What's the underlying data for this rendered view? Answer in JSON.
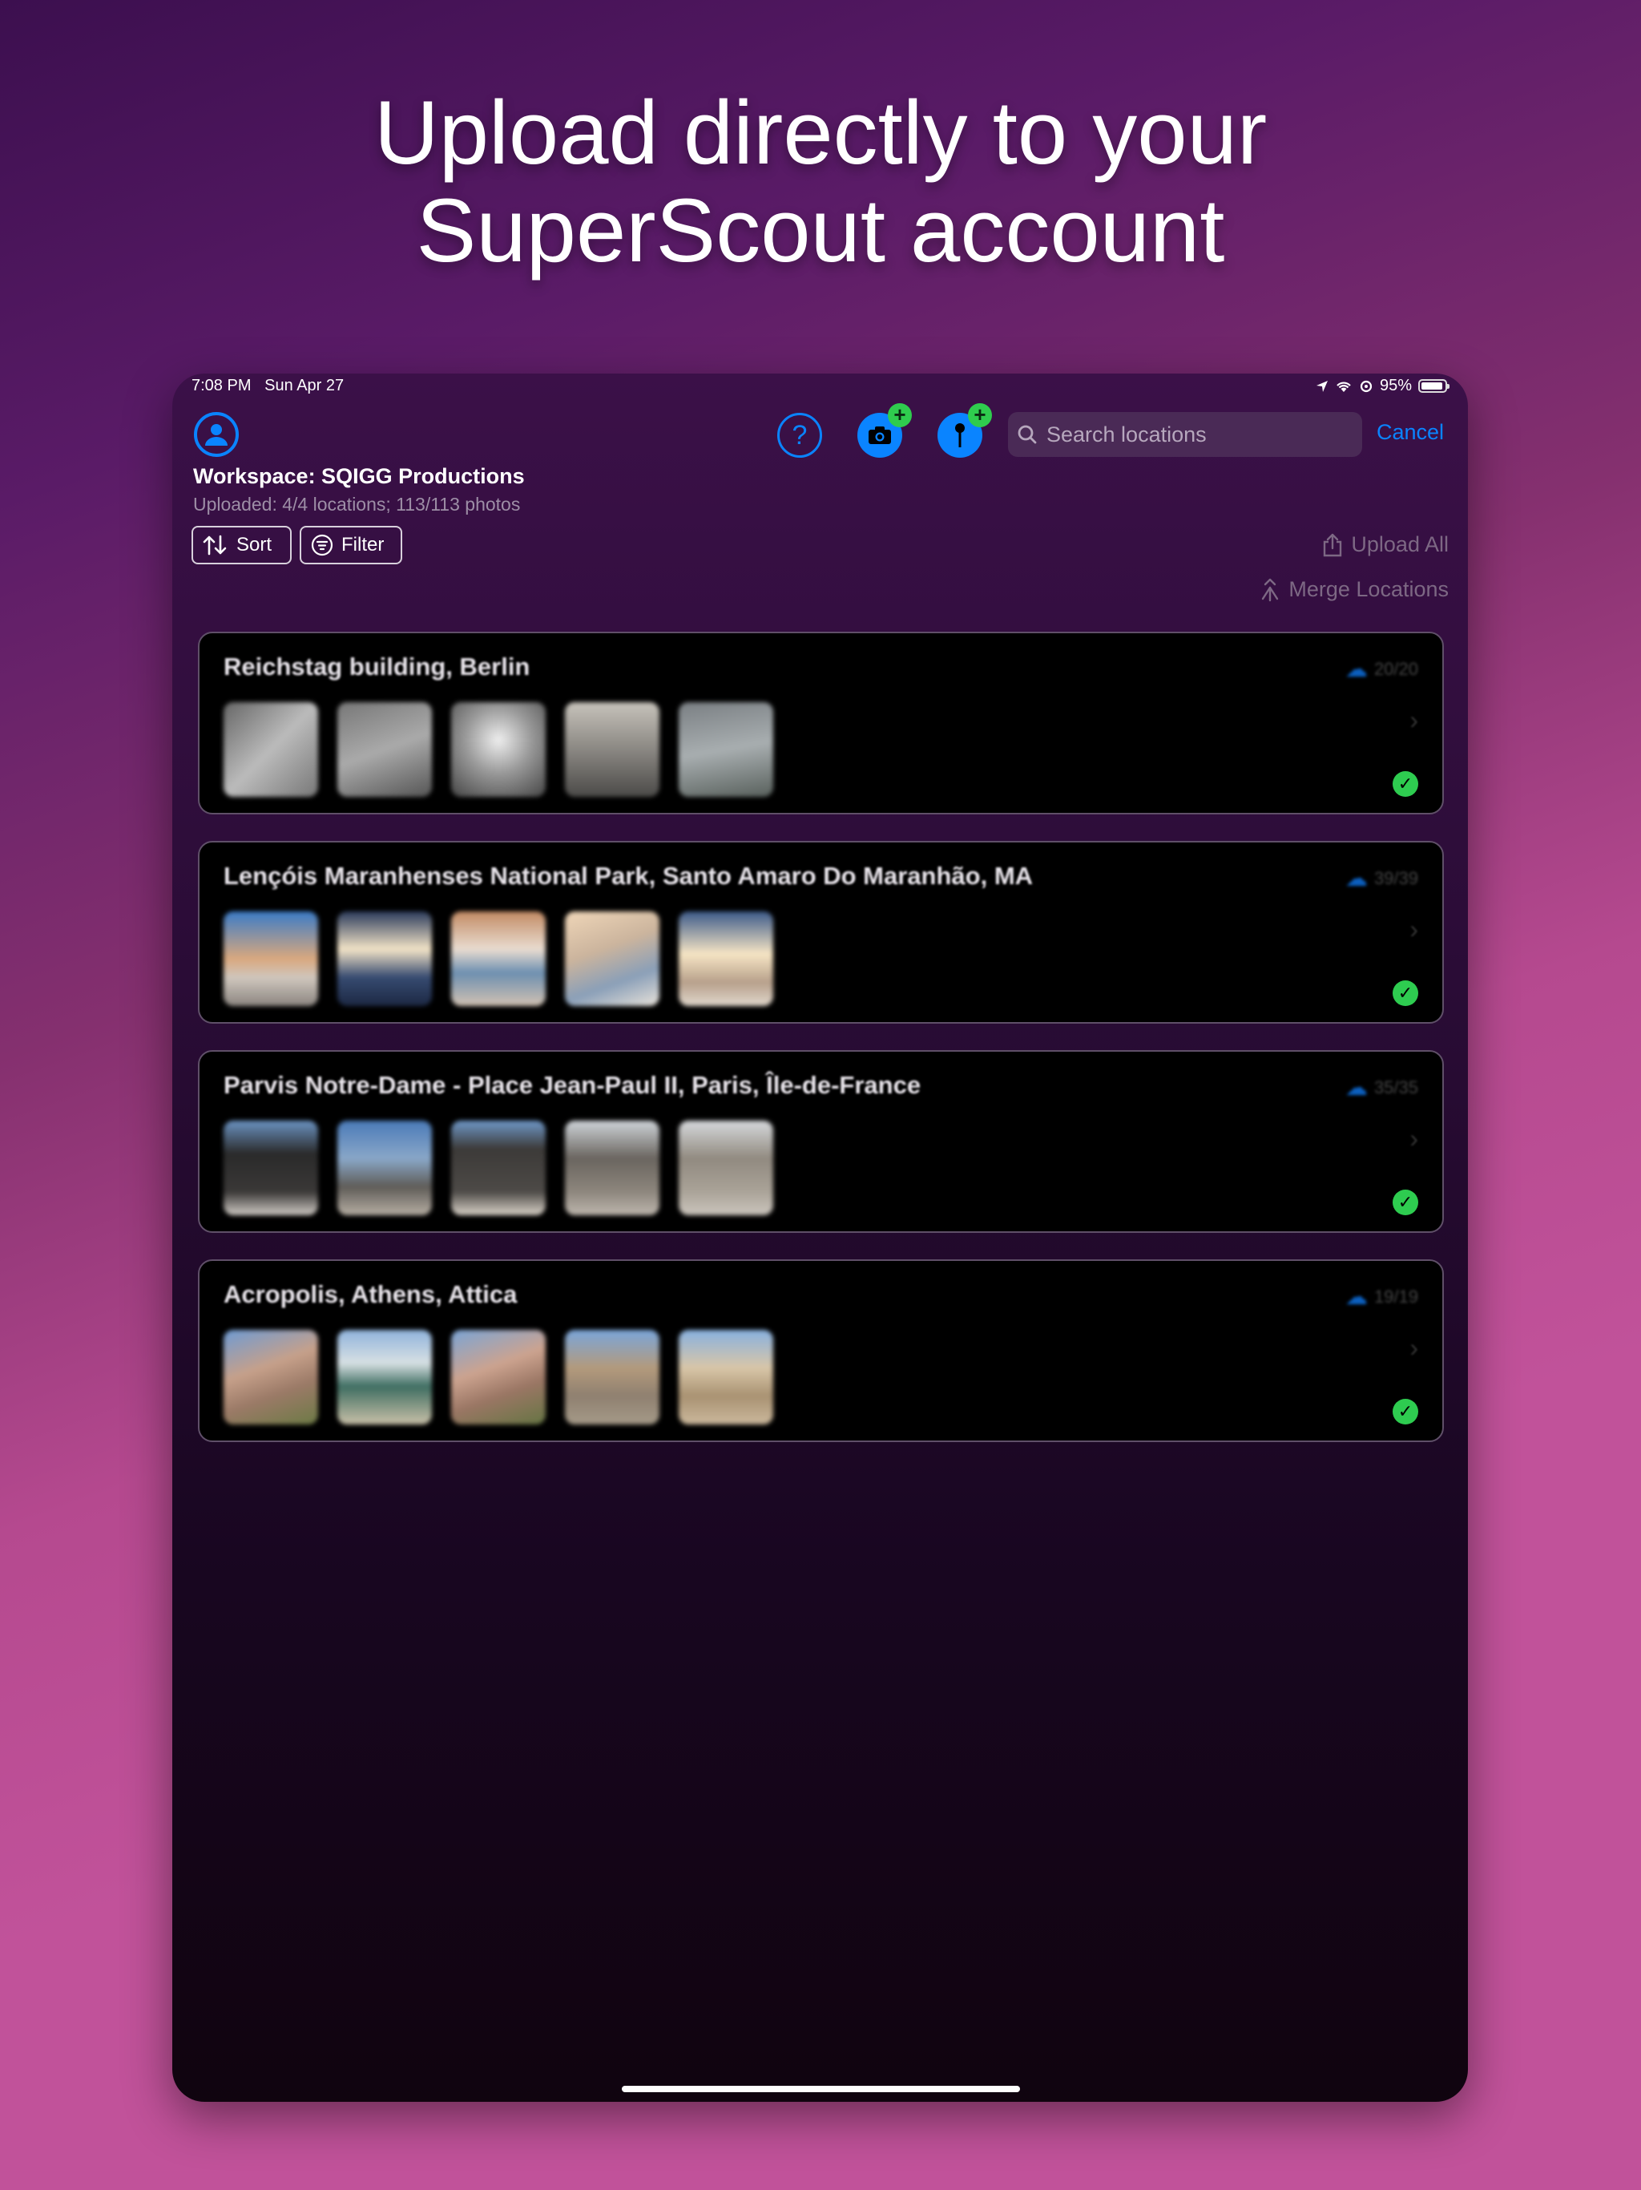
{
  "headline": {
    "line1": "Upload directly to your",
    "line2": "SuperScout account"
  },
  "status_bar": {
    "time": "7:08 PM",
    "date": "Sun Apr 27",
    "battery": "95%"
  },
  "toolbar": {
    "help_label": "?",
    "search_placeholder": "Search locations",
    "cancel_label": "Cancel",
    "plus": "+"
  },
  "workspace": {
    "title": "Workspace: SQIGG Productions",
    "uploaded": "Uploaded: 4/4 locations; 113/113 photos"
  },
  "actions": {
    "sort": "Sort",
    "filter": "Filter",
    "upload_all": "Upload All",
    "merge": "Merge Locations"
  },
  "locations": [
    {
      "name": "Reichstag building, Berlin",
      "count": "20/20"
    },
    {
      "name": "Lençóis Maranhenses National Park, Santo Amaro Do Maranhão, MA",
      "count": "39/39"
    },
    {
      "name": "Parvis Notre-Dame - Place Jean-Paul II, Paris, Île-de-France",
      "count": "35/35"
    },
    {
      "name": "Acropolis, Athens, Attica",
      "count": "19/19"
    }
  ],
  "colors": {
    "accent": "#0a84ff",
    "success": "#2fcc4e"
  },
  "icons": {
    "check": "✓",
    "chevron": "›",
    "cloud": "☁"
  }
}
